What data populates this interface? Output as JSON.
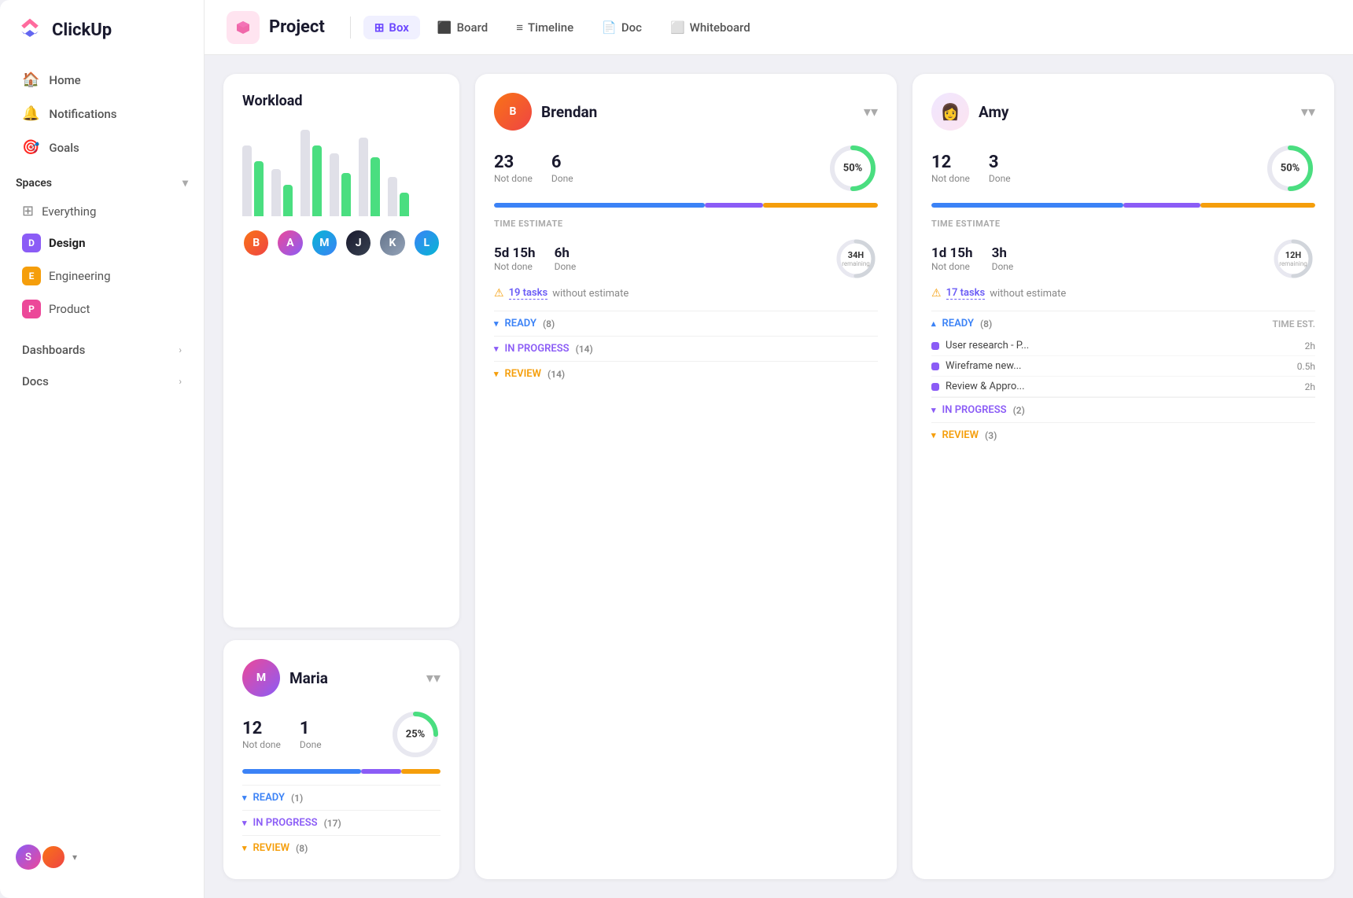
{
  "logo": {
    "text": "ClickUp"
  },
  "sidebar": {
    "nav": [
      {
        "id": "home",
        "label": "Home",
        "icon": "🏠"
      },
      {
        "id": "notifications",
        "label": "Notifications",
        "icon": "🔔"
      },
      {
        "id": "goals",
        "label": "Goals",
        "icon": "🎯"
      }
    ],
    "spaces_label": "Spaces",
    "spaces": [
      {
        "id": "everything",
        "label": "Everything",
        "icon": "⊞",
        "color": null,
        "letter": null
      },
      {
        "id": "design",
        "label": "Design",
        "color": "#8b5cf6",
        "letter": "D"
      },
      {
        "id": "engineering",
        "label": "Engineering",
        "color": "#f59e0b",
        "letter": "E"
      },
      {
        "id": "product",
        "label": "Product",
        "color": "#ec4899",
        "letter": "P"
      }
    ],
    "dashboards": "Dashboards",
    "docs": "Docs"
  },
  "header": {
    "project_label": "Project",
    "tabs": [
      {
        "id": "box",
        "label": "Box",
        "icon": "⊞",
        "active": true
      },
      {
        "id": "board",
        "label": "Board",
        "icon": "▦"
      },
      {
        "id": "timeline",
        "label": "Timeline",
        "icon": "≡"
      },
      {
        "id": "doc",
        "label": "Doc",
        "icon": "📄"
      },
      {
        "id": "whiteboard",
        "label": "Whiteboard",
        "icon": "⬜"
      }
    ]
  },
  "workload": {
    "title": "Workload",
    "bars": [
      {
        "gray": 90,
        "green": 70
      },
      {
        "gray": 60,
        "green": 40
      },
      {
        "gray": 110,
        "green": 90
      },
      {
        "gray": 80,
        "green": 55
      },
      {
        "gray": 100,
        "green": 75
      },
      {
        "gray": 50,
        "green": 30
      }
    ]
  },
  "brendan": {
    "name": "Brendan",
    "not_done": 23,
    "not_done_label": "Not done",
    "done": 6,
    "done_label": "Done",
    "percent": "50%",
    "percent_num": 50,
    "progress_blue": 55,
    "progress_purple": 15,
    "progress_yellow": 30,
    "time_est_label": "TIME ESTIMATE",
    "time_not_done": "5d 15h",
    "time_done": "6h",
    "time_remaining": "34H",
    "time_remaining_label": "remaining",
    "warning_text": "without estimate",
    "tasks_link": "19 tasks",
    "sections": [
      {
        "label": "READY",
        "count": "(8)",
        "status": "ready"
      },
      {
        "label": "IN PROGRESS",
        "count": "(14)",
        "status": "progress"
      },
      {
        "label": "REVIEW",
        "count": "(14)",
        "status": "review"
      }
    ]
  },
  "amy": {
    "name": "Amy",
    "not_done": 12,
    "not_done_label": "Not done",
    "done": 3,
    "done_label": "Done",
    "percent": "50%",
    "percent_num": 50,
    "progress_blue": 50,
    "progress_purple": 20,
    "progress_yellow": 30,
    "time_est_label": "TIME ESTIMATE",
    "time_not_done": "1d 15h",
    "time_done": "3h",
    "time_remaining": "12H",
    "time_remaining_label": "remaining",
    "warning_text": "without estimate",
    "tasks_link": "17 tasks",
    "ready_label": "READY",
    "ready_count": "(8)",
    "time_est_col": "TIME EST.",
    "tasks": [
      {
        "name": "User research - P...",
        "time": "2h"
      },
      {
        "name": "Wireframe new...",
        "time": "0.5h"
      },
      {
        "name": "Review & Appro...",
        "time": "2h"
      }
    ],
    "in_progress_label": "IN PROGRESS",
    "in_progress_count": "(2)",
    "review_label": "REVIEW",
    "review_count": "(3)"
  },
  "maria": {
    "name": "Maria",
    "not_done": 12,
    "not_done_label": "Not done",
    "done": 1,
    "done_label": "Done",
    "percent": "25%",
    "percent_num": 25,
    "progress_blue": 60,
    "progress_purple": 20,
    "progress_yellow": 20,
    "sections": [
      {
        "label": "READY",
        "count": "(1)",
        "status": "ready"
      },
      {
        "label": "IN PROGRESS",
        "count": "(17)",
        "status": "progress"
      },
      {
        "label": "REVIEW",
        "count": "(8)",
        "status": "review"
      }
    ]
  }
}
